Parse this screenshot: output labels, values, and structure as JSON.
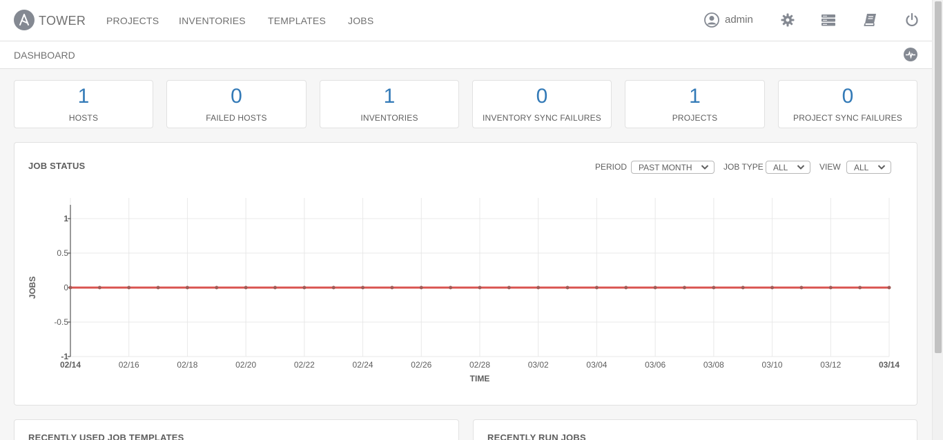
{
  "nav": {
    "brand": "TOWER",
    "links": [
      "PROJECTS",
      "INVENTORIES",
      "TEMPLATES",
      "JOBS"
    ],
    "user": "admin",
    "icons": [
      "user-icon",
      "settings-gear-icon",
      "server-list-icon",
      "documentation-book-icon",
      "power-logout-icon"
    ]
  },
  "breadcrumb": {
    "label": "DASHBOARD",
    "activity_icon": "activity-stream-icon"
  },
  "counts": [
    {
      "value": "1",
      "label": "HOSTS"
    },
    {
      "value": "0",
      "label": "FAILED HOSTS"
    },
    {
      "value": "1",
      "label": "INVENTORIES"
    },
    {
      "value": "0",
      "label": "INVENTORY SYNC FAILURES"
    },
    {
      "value": "1",
      "label": "PROJECTS"
    },
    {
      "value": "0",
      "label": "PROJECT SYNC FAILURES"
    }
  ],
  "job_status": {
    "title": "JOB STATUS",
    "period_label": "PERIOD",
    "period_value": "PAST MONTH",
    "job_type_label": "JOB TYPE",
    "job_type_value": "ALL",
    "view_label": "VIEW",
    "view_value": "ALL"
  },
  "chart_data": {
    "type": "line",
    "title": "",
    "xlabel": "TIME",
    "ylabel": "JOBS",
    "ylim": [
      -1,
      1
    ],
    "yticks": [
      "1",
      "0.5",
      "0",
      "-0.5",
      "-1"
    ],
    "x_tick_labels": [
      "02/14",
      "02/16",
      "02/18",
      "02/20",
      "02/22",
      "02/24",
      "02/26",
      "02/28",
      "03/02",
      "03/04",
      "03/06",
      "03/08",
      "03/10",
      "03/12",
      "03/14"
    ],
    "x": [
      "02/14",
      "02/15",
      "02/16",
      "02/17",
      "02/18",
      "02/19",
      "02/20",
      "02/21",
      "02/22",
      "02/23",
      "02/24",
      "02/25",
      "02/26",
      "02/27",
      "02/28",
      "03/01",
      "03/02",
      "03/03",
      "03/04",
      "03/05",
      "03/06",
      "03/07",
      "03/08",
      "03/09",
      "03/10",
      "03/11",
      "03/12",
      "03/13",
      "03/14"
    ],
    "series": [
      {
        "values": [
          0,
          0,
          0,
          0,
          0,
          0,
          0,
          0,
          0,
          0,
          0,
          0,
          0,
          0,
          0,
          0,
          0,
          0,
          0,
          0,
          0,
          0,
          0,
          0,
          0,
          0,
          0,
          0,
          0
        ],
        "color": "#d9534f"
      }
    ],
    "grid": true
  },
  "bottom": {
    "left_title": "RECENTLY USED JOB TEMPLATES",
    "right_title": "RECENTLY RUN JOBS"
  },
  "colors": {
    "accent": "#337ab7",
    "series": "#d9534f",
    "icon": "#848992"
  }
}
